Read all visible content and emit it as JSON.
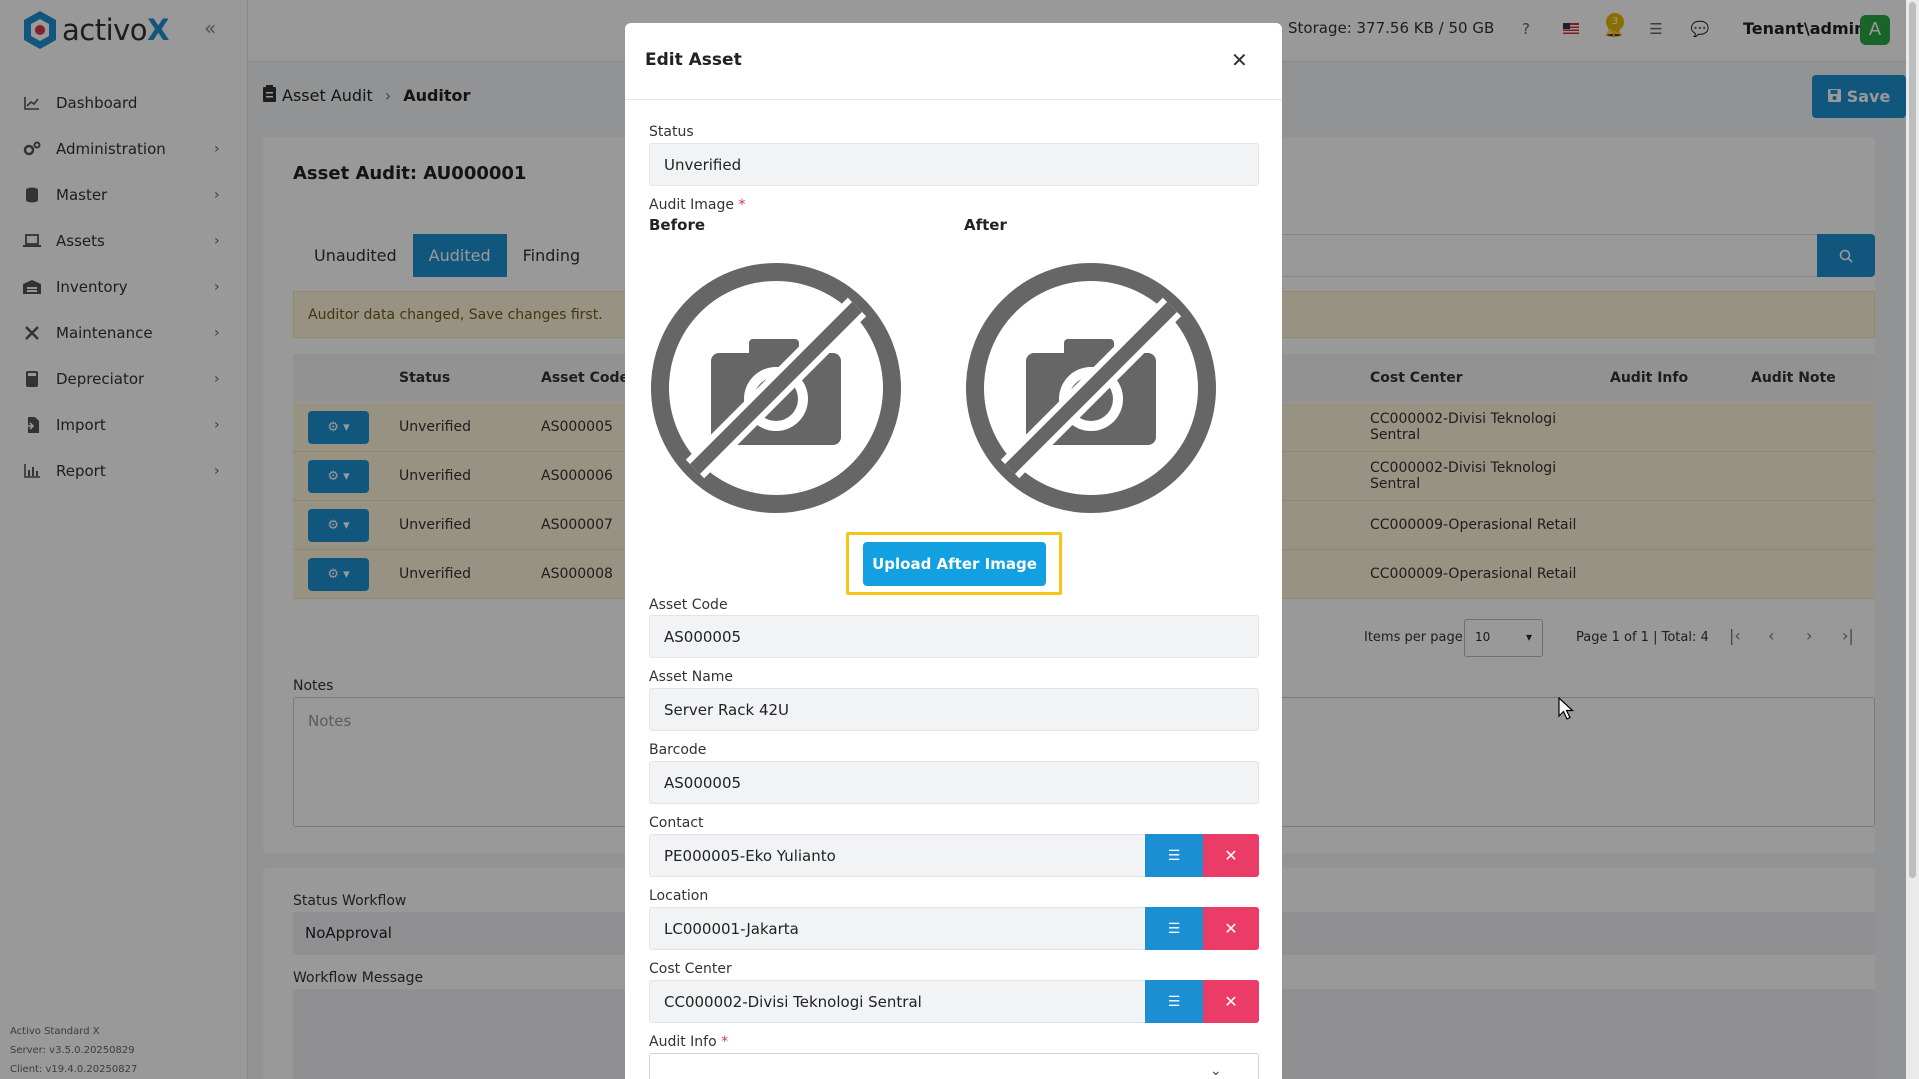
{
  "brand": {
    "name_main": "activo",
    "name_x": "X"
  },
  "sidebar": {
    "items": [
      {
        "label": "Dashboard",
        "icon": "chart-line-icon"
      },
      {
        "label": "Administration",
        "icon": "gears-icon"
      },
      {
        "label": "Master",
        "icon": "database-icon"
      },
      {
        "label": "Assets",
        "icon": "laptop-icon"
      },
      {
        "label": "Inventory",
        "icon": "warehouse-icon"
      },
      {
        "label": "Maintenance",
        "icon": "tools-icon"
      },
      {
        "label": "Depreciator",
        "icon": "calculator-icon"
      },
      {
        "label": "Import",
        "icon": "file-import-icon"
      },
      {
        "label": "Report",
        "icon": "chart-bar-icon"
      }
    ],
    "footer": {
      "product": "Activo Standard X",
      "server": "Server: v3.5.0.20250829",
      "client": "Client: v19.4.0.20250827"
    }
  },
  "topbar": {
    "storage": "Storage: 377.56 KB / 50 GB",
    "notif_count": "3",
    "user": "Tenant\\admin",
    "avatar": "A"
  },
  "breadcrumb": {
    "parent": "Asset Audit",
    "current": "Auditor"
  },
  "toolbar": {
    "save_label": "Save"
  },
  "page": {
    "title": "Asset Audit: AU000001",
    "tabs": [
      "Unaudited",
      "Audited",
      "Finding"
    ],
    "alert": "Auditor data changed, Save changes first.",
    "table": {
      "headers": {
        "status": "Status",
        "asset_code": "Asset Code",
        "cost_center": "Cost Center",
        "audit_info": "Audit Info",
        "audit_note": "Audit Note"
      },
      "rows": [
        {
          "status": "Unverified",
          "asset_code": "AS000005",
          "cost_center_1": "CC000002-Divisi Teknologi",
          "cost_center_2": "Sentral"
        },
        {
          "status": "Unverified",
          "asset_code": "AS000006",
          "cost_center_1": "CC000002-Divisi Teknologi",
          "cost_center_2": "Sentral"
        },
        {
          "status": "Unverified",
          "asset_code": "AS000007",
          "cost_center_1": "CC000009-Operasional Retail",
          "cost_center_2": ""
        },
        {
          "status": "Unverified",
          "asset_code": "AS000008",
          "cost_center_1": "CC000009-Operasional Retail",
          "cost_center_2": ""
        }
      ]
    },
    "pager": {
      "items_label": "Items per page",
      "per_page": "10",
      "info": "Page 1 of 1 | Total: 4"
    },
    "notes": {
      "label": "Notes",
      "placeholder": "Notes"
    },
    "workflow": {
      "status_label": "Status Workflow",
      "status_value": "NoApproval",
      "message_label": "Workflow Message"
    }
  },
  "modal": {
    "title": "Edit Asset",
    "status": {
      "label": "Status",
      "value": "Unverified"
    },
    "audit_image": {
      "label": "Audit Image",
      "required": "*",
      "before": "Before",
      "after": "After",
      "upload_label": "Upload After Image"
    },
    "asset_code": {
      "label": "Asset Code",
      "value": "AS000005"
    },
    "asset_name": {
      "label": "Asset Name",
      "value": "Server Rack 42U"
    },
    "barcode": {
      "label": "Barcode",
      "value": "AS000005"
    },
    "contact": {
      "label": "Contact",
      "value": "PE000005-Eko Yulianto"
    },
    "location": {
      "label": "Location",
      "value": "LC000001-Jakarta"
    },
    "cost_center": {
      "label": "Cost Center",
      "value": "CC000002-Divisi Teknologi Sentral"
    },
    "audit_info": {
      "label": "Audit Info",
      "required": "*"
    }
  },
  "colors": {
    "primary": "#1b8fd1",
    "danger": "#ea3c67",
    "highlight": "#f5c518",
    "warning_bg": "#fcf3d9"
  }
}
